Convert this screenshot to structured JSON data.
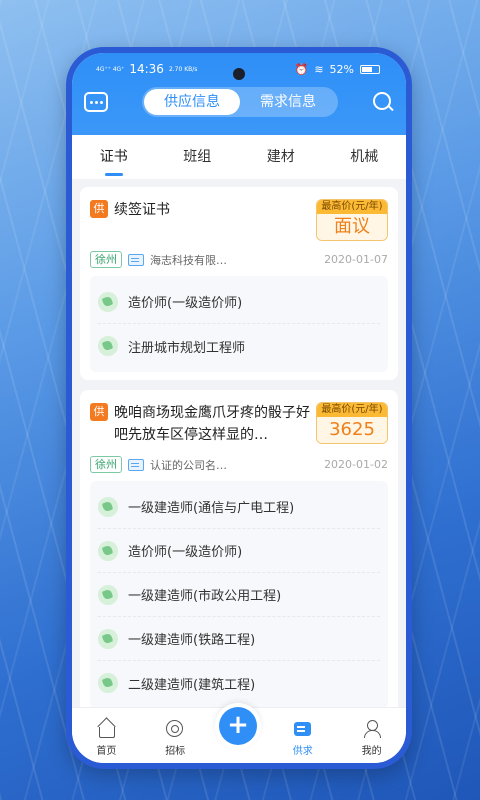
{
  "status_bar": {
    "network": "4G⁺⁺ 4G⁺",
    "time": "14:36",
    "speed": "2.70 KB/s",
    "battery": "52%"
  },
  "header": {
    "segments": [
      "供应信息",
      "需求信息"
    ],
    "active_segment": 0
  },
  "categories": [
    "证书",
    "班组",
    "建材",
    "机械"
  ],
  "cards": [
    {
      "tag": "供",
      "title": "续签证书",
      "price_label": "最高价(元/年)",
      "price_value": "面议",
      "city": "徐州",
      "company": "海志科技有限…",
      "date": "2020-01-07",
      "items": [
        "造价师(一级造价师)",
        "注册城市规划工程师"
      ]
    },
    {
      "tag": "供",
      "title": "晚咱商场现金鹰爪牙疼的骰子好吧先放车区停这样显的…",
      "price_label": "最高价(元/年)",
      "price_value": "3625",
      "city": "徐州",
      "company": "认证的公司名…",
      "date": "2020-01-02",
      "items": [
        "一级建造师(通信与广电工程)",
        "造价师(一级造价师)",
        "一级建造师(市政公用工程)",
        "一级建造师(铁路工程)",
        "二级建造师(建筑工程)"
      ]
    }
  ],
  "tabbar": {
    "tabs": [
      "首页",
      "招标",
      "供求",
      "我的"
    ],
    "fab_label": "+"
  }
}
